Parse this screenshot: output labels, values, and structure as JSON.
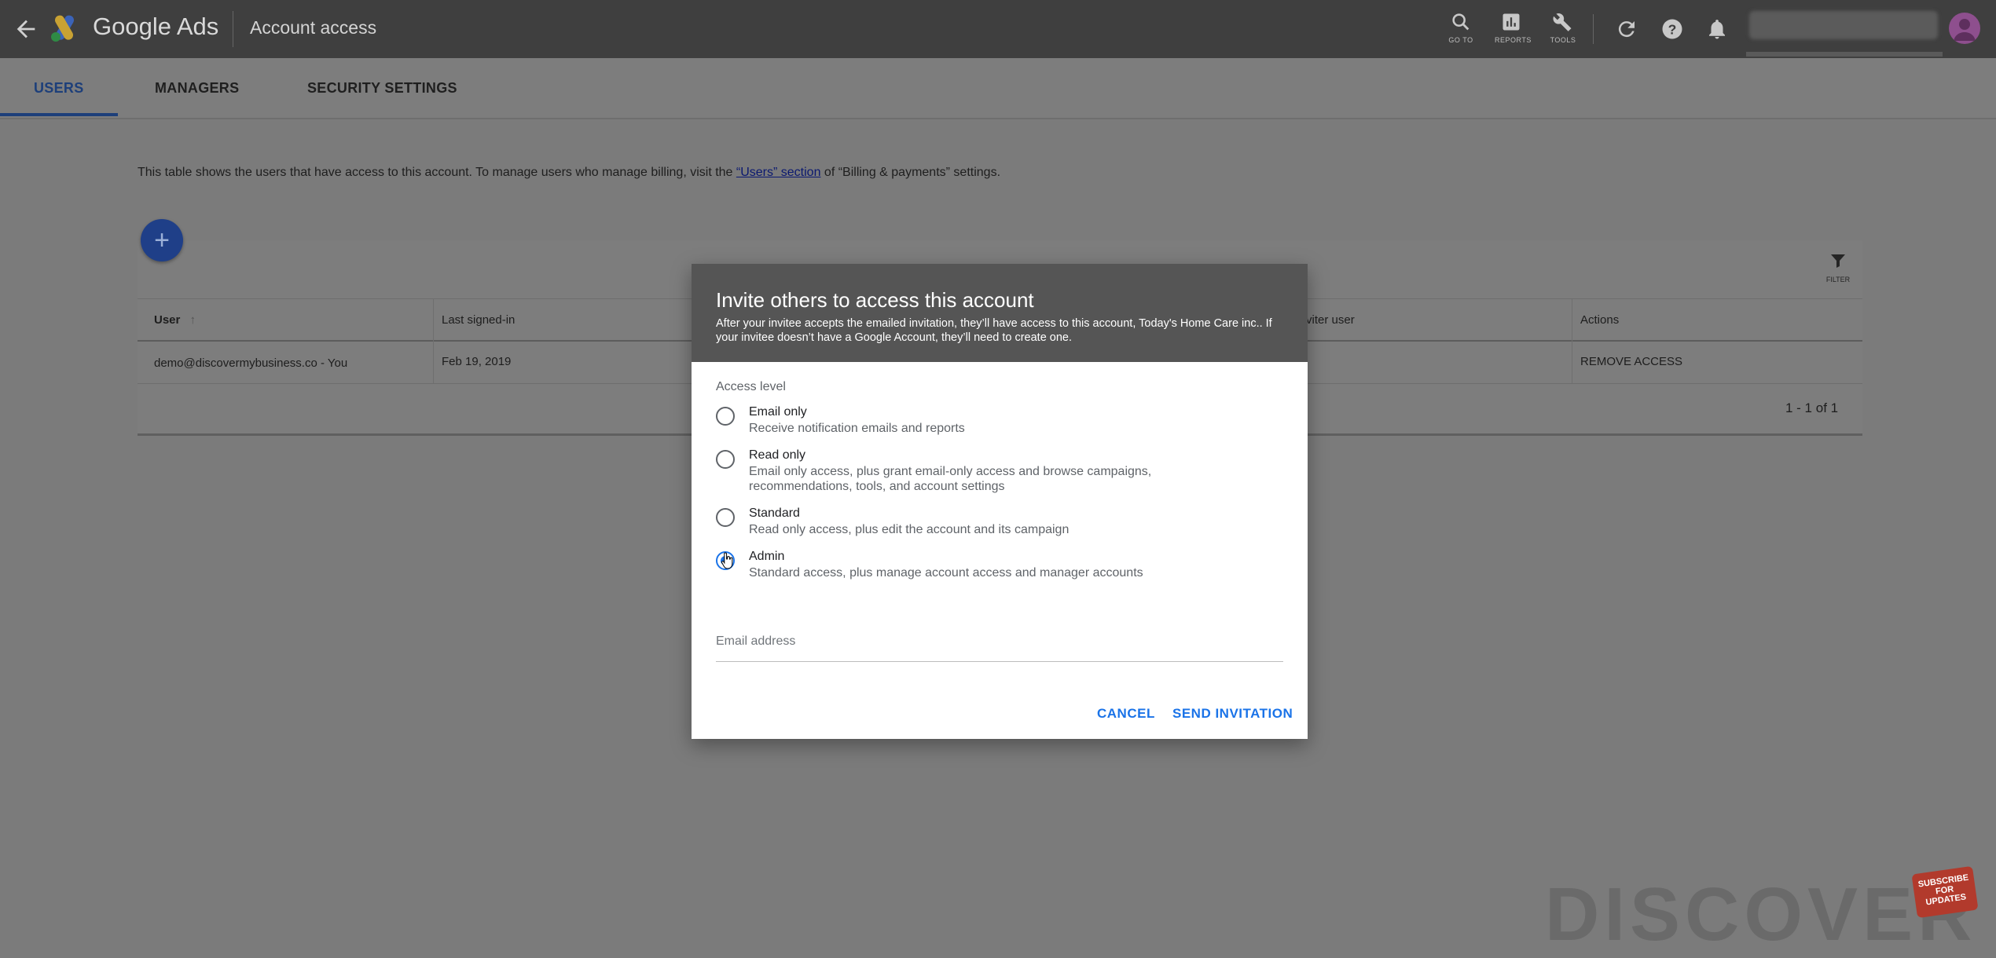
{
  "header": {
    "brand": "Google Ads",
    "page_title": "Account access",
    "icons": [
      {
        "name": "search-icon",
        "label": "GO TO"
      },
      {
        "name": "reports-icon",
        "label": "REPORTS"
      },
      {
        "name": "tools-icon",
        "label": "TOOLS"
      }
    ]
  },
  "tabs": [
    {
      "label": "USERS",
      "active": true
    },
    {
      "label": "MANAGERS",
      "active": false
    },
    {
      "label": "SECURITY SETTINGS",
      "active": false
    }
  ],
  "info": {
    "prefix": "This table shows the users that have access to this account. To manage users who manage billing, visit the ",
    "link": "“Users” section",
    "suffix": " of “Billing & payments” settings."
  },
  "table": {
    "add_label": "+",
    "filter_label": "FILTER",
    "headers": {
      "user": "User",
      "last_signed_in": "Last signed-in",
      "inviter": "viter user",
      "actions": "Actions"
    },
    "row": {
      "user": "demo@discovermybusiness.co - You",
      "last_signed_in": "Feb 19, 2019",
      "action": "REMOVE ACCESS"
    },
    "pagination": "1 - 1 of 1"
  },
  "dialog": {
    "title": "Invite others to access this account",
    "subtitle": "After your invitee accepts the emailed invitation, they’ll have access to this account, Today's Home Care inc.. If your invitee doesn’t have a Google Account, they’ll need to create one.",
    "access_level_label": "Access level",
    "options": [
      {
        "title": "Email only",
        "desc": "Receive notification emails and reports",
        "checked": false
      },
      {
        "title": "Read only",
        "desc": "Email only access, plus grant email-only access and browse campaigns, recommendations, tools, and account settings",
        "checked": false
      },
      {
        "title": "Standard",
        "desc": "Read only access, plus edit the account and its campaign",
        "checked": false
      },
      {
        "title": "Admin",
        "desc": "Standard access, plus manage account access and manager accounts",
        "checked": true
      }
    ],
    "email_placeholder": "Email address",
    "email_value": "",
    "cancel_label": "CANCEL",
    "send_label": "SEND INVITATION"
  },
  "watermark": {
    "text": "DISCOVER",
    "badge": "SUBSCRIBE FOR UPDATES"
  },
  "colors": {
    "accent": "#1a73e8",
    "topbar": "#3f3f3f",
    "dialog_header": "#555555",
    "fab": "#1f3f88"
  }
}
